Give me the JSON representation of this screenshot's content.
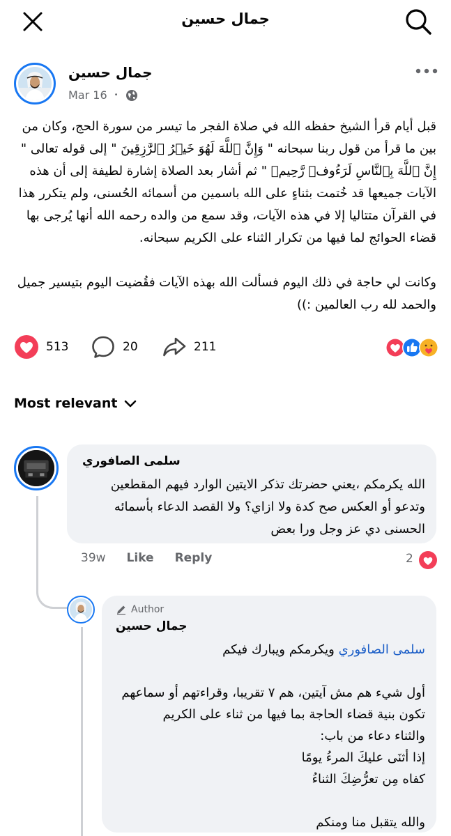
{
  "header": {
    "title": "جمال حسين"
  },
  "post": {
    "author": "جمال حسين",
    "date": "Mar 16",
    "text": "قبل أيام قرأ الشيخ حفظه الله في صلاة الفجر ما تيسر من سورة الحج، وكان من بين ما قرأ من قول ربنا سبحانه \" وَإِنَّ ٱللَّهَ لَهُوَ خَيۡرُ ٱلرَّٰزِقِينَ \" إلى قوله تعالى \" إِنَّ ٱللَّهَ بِٱلنَّاسِ لَرَءُوفٞ رَّحِيمٞ \" ثم أشار بعد الصلاة إشارة لطيفة إلى أن هذه الآيات جميعها قد خُتمت بثناءٍ على الله باسمين من أسمائه الحُسنى، ولم يتكرر هذا في القرآن متتاليا إلا في هذه الآيات، وقد سمع من والده رحمه الله أنها يُرجى بها قضاء الحوائج لما فيها من تكرار الثناء على الكريم سبحانه.\n\nوكانت لي حاجة في ذلك اليوم فسألت الله بهذه الآيات فقُضيت اليوم بتيسير جميل والحمد لله رب العالمين :))",
    "like_count": "513",
    "comment_count": "20",
    "share_count": "211"
  },
  "sort": {
    "label": "Most relevant"
  },
  "comment1": {
    "author": "سلمى الصافوري",
    "text": "الله يكرمكم ،يعني حضرتك تذكر الايتين الوارد فيهم المقطعين وتدعو أو العكس صح كدة ولا ازاي؟ ولا القصد الدعاء بأسمائه الحسنى دي عز وجل ورا بعض",
    "time": "39w",
    "like_label": "Like",
    "reply_label": "Reply",
    "reaction_count": "2"
  },
  "reply": {
    "badge": "Author",
    "author": "جمال حسين",
    "mention": "سلمى الصافوري",
    "mention_rest": " ويكرمكم ويبارك فيكم",
    "text": "أول شيء هم مش آيتين، هم ٧ تقريبا، وقراءتهم أو سماعهم تكون بنية قضاء الحاجة بما فيها من ثناء على الكريم\nوالثناء دعاء من باب:\nإذا أثنَى عليكَ المرءُ يومًا\nكفاه مِن تعرُّضِكَ الثناءُ\n\nوالله يتقبل منا ومنكم"
  },
  "colors": {
    "accent": "#1877f2",
    "heart": "#f33e58",
    "bubble": "#f0f2f5",
    "muted": "#65676b"
  }
}
